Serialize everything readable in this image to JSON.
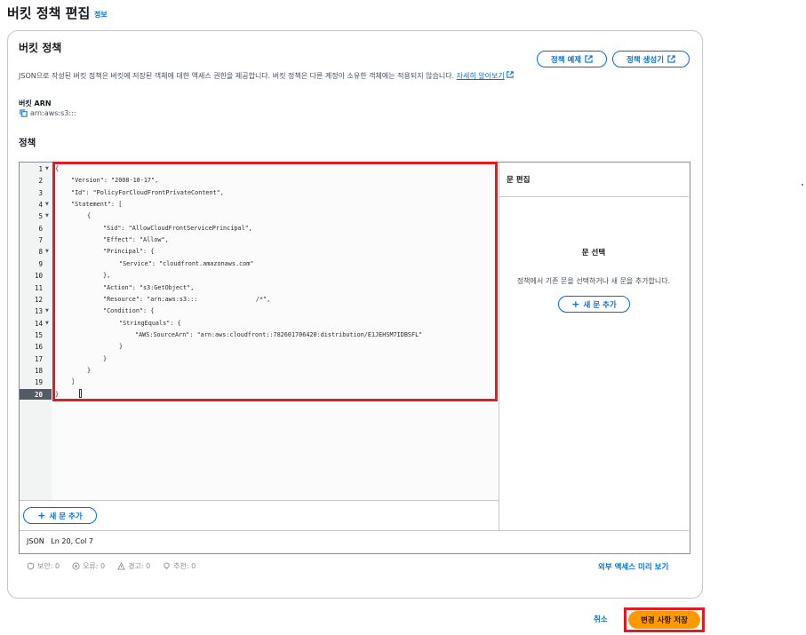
{
  "page": {
    "title": "버킷 정책 편집",
    "info_link": "정보"
  },
  "panel": {
    "title": "버킷 정책",
    "policy_examples_button": "정책 예제",
    "policy_generator_button": "정책 생성기",
    "description": "JSON으로 작성된 버킷 정책은 버킷에 저장된 객체에 대한 액세스 권한을 제공합니다. 버킷 정책은 다른 계정이 소유한 객체에는 적용되지 않습니다.",
    "learn_more": "자세히 알아보기",
    "arn_label": "버킷 ARN",
    "arn_value": "arn:aws:s3:::",
    "policy_label": "정책"
  },
  "editor": {
    "lines": [
      {
        "n": "1",
        "fold": true,
        "indent": 0,
        "text": "{"
      },
      {
        "n": "2",
        "fold": false,
        "indent": 1,
        "text": "\"Version\": \"2008-10-17\","
      },
      {
        "n": "3",
        "fold": false,
        "indent": 1,
        "text": "\"Id\": \"PolicyForCloudFrontPrivateContent\","
      },
      {
        "n": "4",
        "fold": true,
        "indent": 1,
        "text": "\"Statement\": ["
      },
      {
        "n": "5",
        "fold": true,
        "indent": 2,
        "text": "{"
      },
      {
        "n": "6",
        "fold": false,
        "indent": 3,
        "text": "\"Sid\": \"AllowCloudFrontServicePrincipal\","
      },
      {
        "n": "7",
        "fold": false,
        "indent": 3,
        "text": "\"Effect\": \"Allow\","
      },
      {
        "n": "8",
        "fold": true,
        "indent": 3,
        "text": "\"Principal\": {"
      },
      {
        "n": "9",
        "fold": false,
        "indent": 4,
        "text": "\"Service\": \"cloudfront.amazonaws.com\""
      },
      {
        "n": "10",
        "fold": false,
        "indent": 3,
        "text": "},"
      },
      {
        "n": "11",
        "fold": false,
        "indent": 3,
        "text": "\"Action\": \"s3:GetObject\","
      },
      {
        "n": "12",
        "fold": false,
        "indent": 3,
        "text": "\"Resource\": \"arn:aws:s3:::                /*\","
      },
      {
        "n": "13",
        "fold": true,
        "indent": 3,
        "text": "\"Condition\": {"
      },
      {
        "n": "14",
        "fold": true,
        "indent": 4,
        "text": "\"StringEquals\": {"
      },
      {
        "n": "15",
        "fold": false,
        "indent": 5,
        "text": "\"AWS:SourceArn\": \"arn:aws:cloudfront::782601706420:distribution/E1JEHSM7IDBSFL\""
      },
      {
        "n": "16",
        "fold": false,
        "indent": 4,
        "text": "}"
      },
      {
        "n": "17",
        "fold": false,
        "indent": 3,
        "text": "}"
      },
      {
        "n": "18",
        "fold": false,
        "indent": 2,
        "text": "}"
      },
      {
        "n": "19",
        "fold": false,
        "indent": 1,
        "text": "]"
      },
      {
        "n": "20",
        "fold": false,
        "indent": 0,
        "text": "}"
      }
    ],
    "active_line": "20",
    "add_statement_button": "새 문 추가",
    "status": "JSON   Ln 20, Col 7"
  },
  "statement_pane": {
    "header": "문 편집",
    "title": "문 선택",
    "description": "정책에서 기존 문을 선택하거나 새 문을 추가합니다.",
    "add_button": "새 문 추가"
  },
  "checks": {
    "security": "보안: 0",
    "errors": "오류: 0",
    "warnings": "경고: 0",
    "suggestions": "추천: 0",
    "preview_link": "외부 액세스 미리 보기"
  },
  "footer": {
    "cancel": "취소",
    "save": "변경 사항 저장"
  },
  "colors": {
    "accent": "#0972d3",
    "save": "#ff9900",
    "highlight": "#e01b24"
  }
}
